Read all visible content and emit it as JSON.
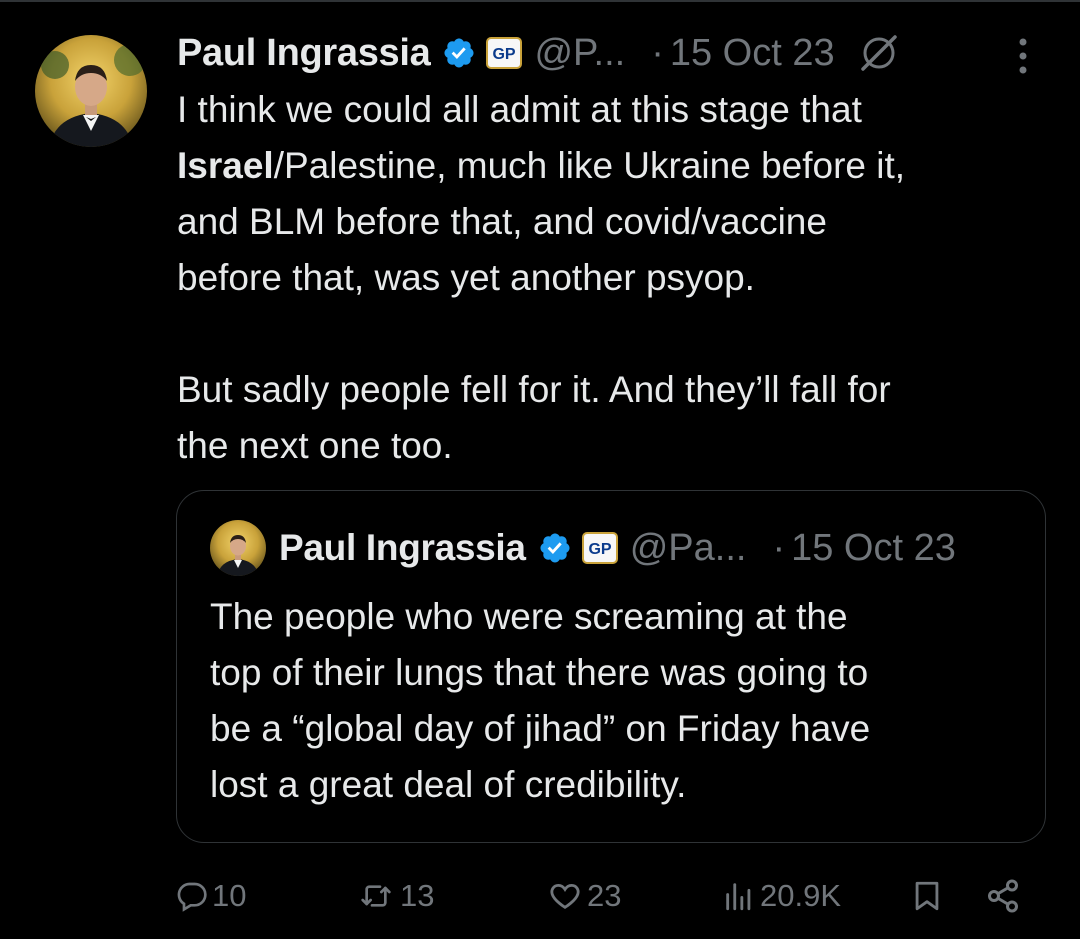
{
  "tweet": {
    "author_name": "Paul Ingrassia",
    "handle": "@P...",
    "separator": "·",
    "date": "15 Oct 23",
    "text_bold": "Israel",
    "text_line1": "I think we could all admit at this stage that\n",
    "text_rest": "/Palestine, much like Ukraine before it,\nand BLM before that, and covid/vaccine\nbefore that, was yet another psyop.\n\nBut sadly people fell for it. And they’ll fall for\nthe next one too.",
    "badge_text": "GP"
  },
  "quoted_tweet": {
    "author_name": "Paul Ingrassia",
    "handle": "@Pa...",
    "separator": "·",
    "date": "15 Oct 23",
    "text": "The people who were screaming at the\ntop of their lungs that there was going to\nbe a “global day of jihad” on Friday have\nlost a great deal of credibility.",
    "badge_text": "GP"
  },
  "actions": {
    "replies": "10",
    "reposts": "13",
    "likes": "23",
    "views": "20.9K"
  },
  "icons": {
    "verified": "verified-icon",
    "gp": "gp-badge-icon",
    "grok": "grok-icon",
    "more": "more-icon",
    "reply": "reply-icon",
    "repost": "repost-icon",
    "like": "heart-icon",
    "views": "views-icon",
    "bookmark": "bookmark-icon",
    "share": "share-icon"
  },
  "colors": {
    "background": "#000000",
    "text": "#e7e9ea",
    "secondary": "#71767b",
    "verified": "#1d9bf0",
    "border": "#2f3336"
  }
}
